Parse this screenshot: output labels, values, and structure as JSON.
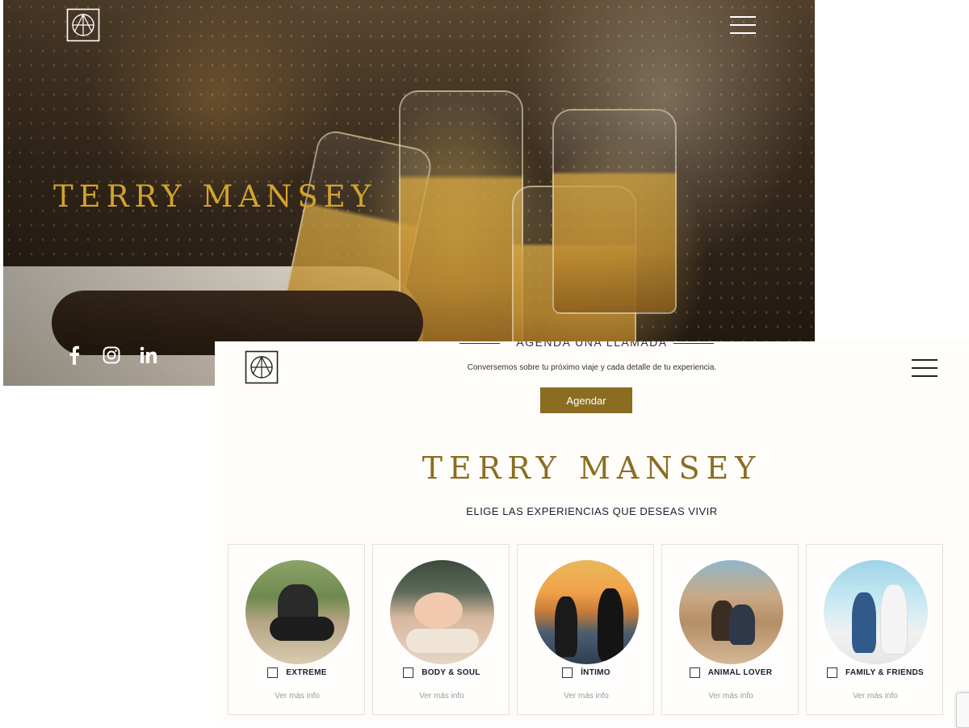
{
  "hero": {
    "logo_icon": "compass-logo-icon",
    "menu_icon": "hamburger-menu-icon",
    "title": "TERRY MANSEY",
    "title_color": "#d3a32c",
    "social": [
      {
        "name": "facebook",
        "icon": "facebook-icon",
        "glyph": "f"
      },
      {
        "name": "instagram",
        "icon": "instagram-icon",
        "glyph": ""
      },
      {
        "name": "linkedin",
        "icon": "linkedin-icon",
        "glyph": "in"
      }
    ]
  },
  "panel": {
    "logo_icon": "compass-logo-icon",
    "menu_icon": "hamburger-menu-icon",
    "call": {
      "title": "AGENDA UNA LLAMADA",
      "subtitle": "Conversemos sobre tu próximo viaje y cada detalle de tu experiencia.",
      "button_label": "Agendar"
    },
    "title": "TERRY MANSEY",
    "subtitle": "ELIGE LAS EXPERIENCIAS QUE DESEAS VIVIR",
    "accent_color": "#8b6d22",
    "experiences": [
      {
        "label": "EXTREME",
        "more": "Ver más info",
        "checked": false
      },
      {
        "label": "BODY & SOUL",
        "more": "Ver más info",
        "checked": false
      },
      {
        "label": "ÍNTIMO",
        "more": "Ver más info",
        "checked": false
      },
      {
        "label": "ANIMAL LOVER",
        "more": "Ver más info",
        "checked": false
      },
      {
        "label": "FAMILY & FRIENDS",
        "more": "Ver más info",
        "checked": false
      }
    ]
  }
}
